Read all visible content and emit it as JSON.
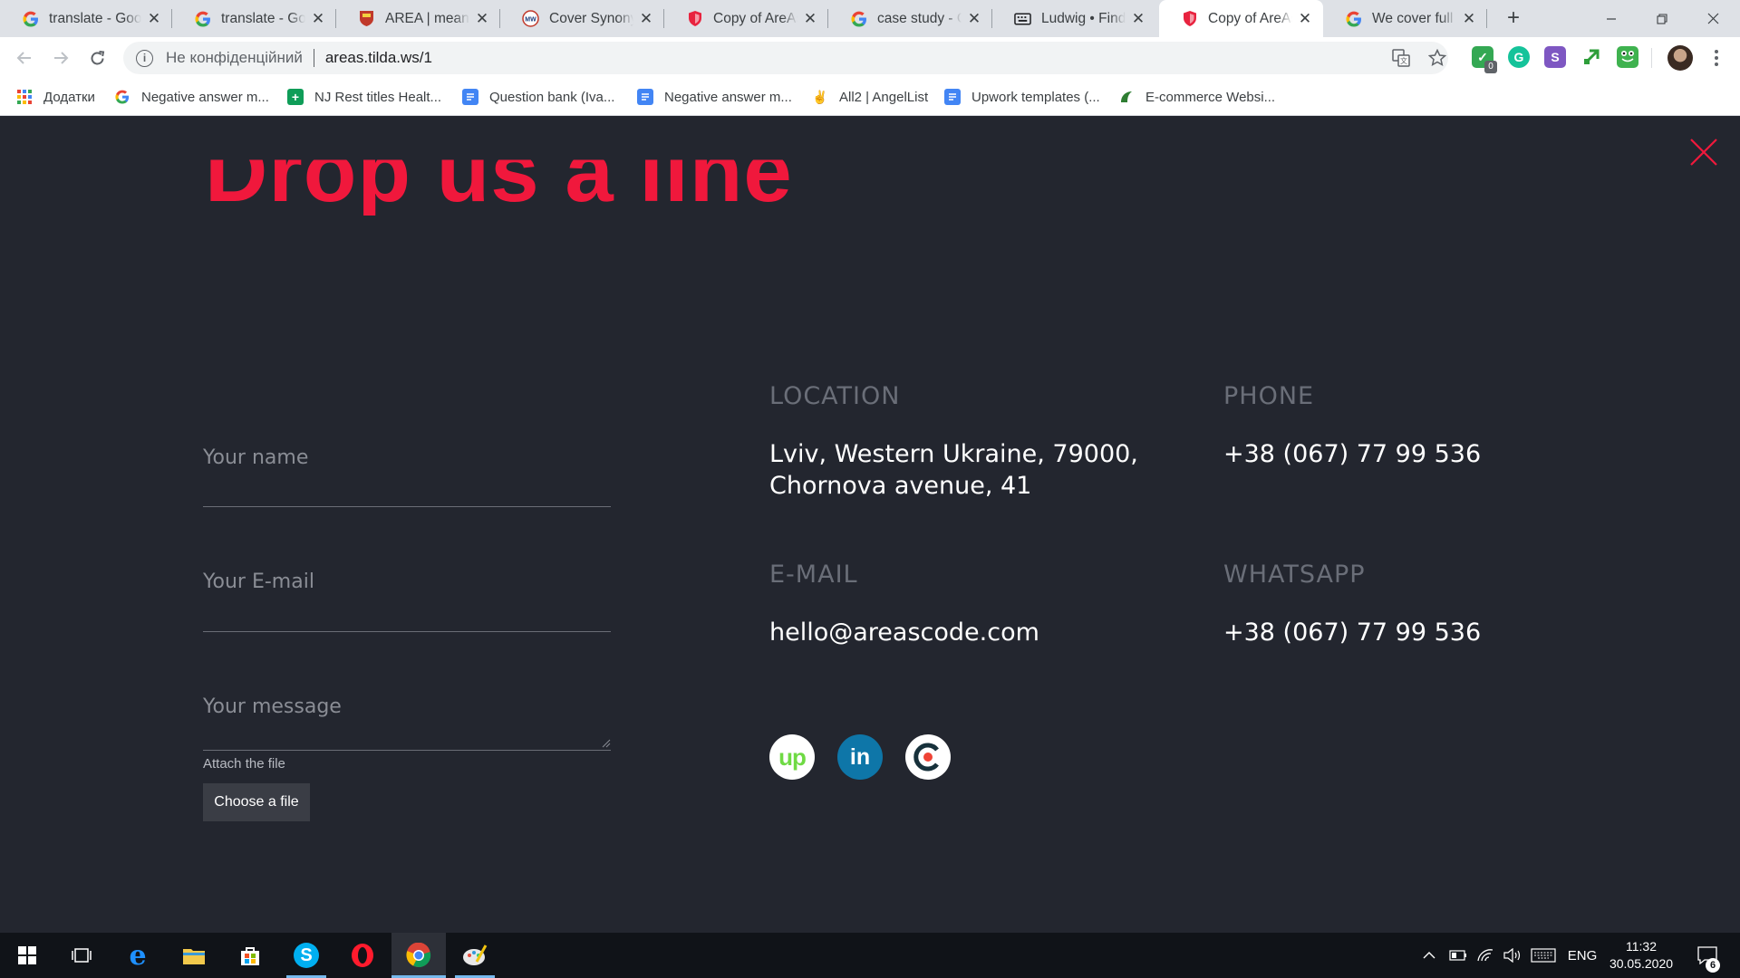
{
  "browser": {
    "tabs": [
      {
        "title": "translate - Google Search",
        "icon": "google-icon",
        "active": false
      },
      {
        "title": "translate - Google Search",
        "icon": "google-icon",
        "active": false
      },
      {
        "title": "AREA | meaning in the Cambridge",
        "icon": "cambridge-icon",
        "active": false
      },
      {
        "title": "Cover Synonyms",
        "icon": "merriam-webster-icon",
        "active": false
      },
      {
        "title": "Copy of AreAs",
        "icon": "tilda-shield-icon",
        "active": false
      },
      {
        "title": "case study - Google Search",
        "icon": "google-icon",
        "active": false
      },
      {
        "title": "Ludwig • Find your English",
        "icon": "ludwig-keyboard-icon",
        "active": false
      },
      {
        "title": "Copy of AreAs",
        "icon": "tilda-shield-icon",
        "active": true
      },
      {
        "title": "We cover full cycle",
        "icon": "google-icon",
        "active": false
      }
    ],
    "new_tab": "+",
    "address": {
      "security_text": "Не конфіденційний",
      "url": "areas.tilda.ws/1"
    },
    "bookmarks": [
      {
        "label": "Додатки",
        "icon": "apps-grid-icon"
      },
      {
        "label": "Negative answer m...",
        "icon": "google-icon"
      },
      {
        "label": "NJ Rest titles Healt...",
        "icon": "sheets-icon"
      },
      {
        "label": "Question bank (Iva...",
        "icon": "docs-icon"
      },
      {
        "label": "Negative answer m...",
        "icon": "docs-icon"
      },
      {
        "label": "All2 | AngelList",
        "icon": "angellist-icon"
      },
      {
        "label": "Upwork templates (...",
        "icon": "docs-icon"
      },
      {
        "label": "E-commerce Websi...",
        "icon": "site-icon"
      }
    ],
    "extension_badge": "0"
  },
  "page": {
    "headline": "Drop us a line",
    "form": {
      "name_placeholder": "Your name",
      "email_placeholder": "Your E-mail",
      "message_placeholder": "Your message",
      "attach_label": "Attach the file",
      "choose_button": "Choose a file"
    },
    "contacts": {
      "location_label": "LOCATION",
      "location_line1": "Lviv, Western Ukraine, 79000,",
      "location_line2": "Chornova avenue, 41",
      "phone_label": "PHONE",
      "phone_value": "+38 (067) 77 99 536",
      "email_label": "E-MAIL",
      "email_value": "hello@areascode.com",
      "whatsapp_label": "WHATSAPP",
      "whatsapp_value": "+38 (067) 77 99 536"
    },
    "social": [
      {
        "name": "upwork-icon",
        "text": "up"
      },
      {
        "name": "linkedin-icon",
        "text": "in"
      },
      {
        "name": "clutch-icon",
        "text": ""
      }
    ],
    "colors": {
      "accent": "#f0183c",
      "background": "#23262f"
    }
  },
  "taskbar": {
    "language": "ENG",
    "time": "11:32",
    "date": "30.05.2020",
    "notification_count": "6"
  }
}
